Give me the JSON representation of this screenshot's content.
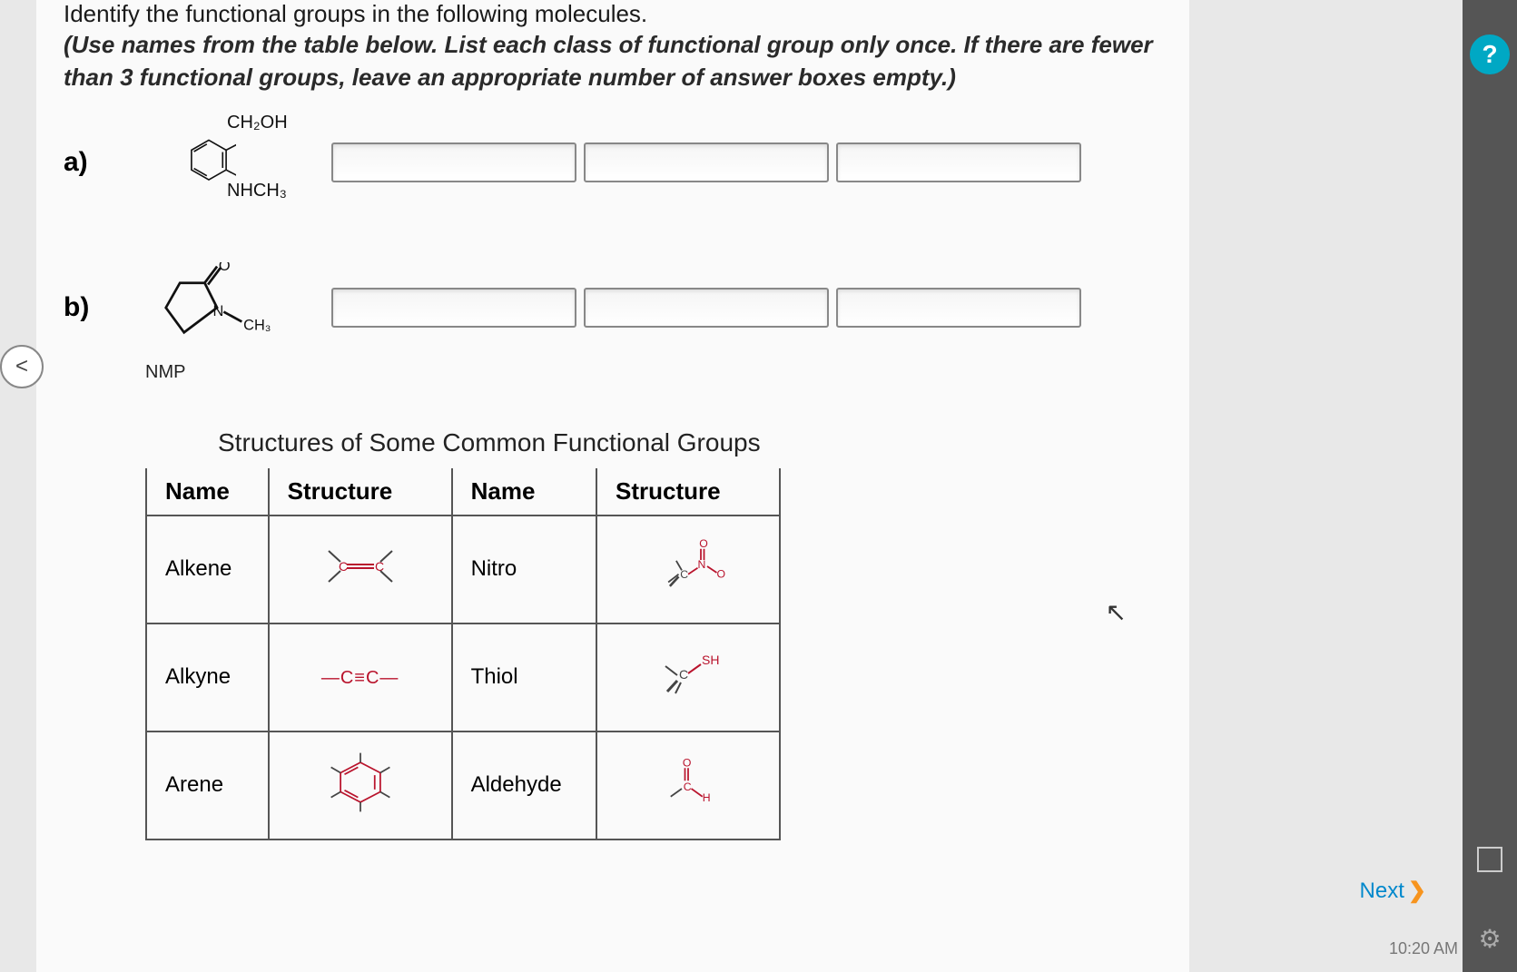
{
  "question": {
    "title": "Identify the functional groups in the following molecules.",
    "instruction": "(Use names from the table below. List each class of functional group only once. If there are fewer than 3 functional groups, leave an appropriate number of answer boxes empty.)"
  },
  "parts": {
    "a": {
      "label": "a)",
      "top_sub": "CH₂OH",
      "bottom_sub": "NHCH₃"
    },
    "b": {
      "label": "b)",
      "o_label": "O",
      "n_sub": "CH₃",
      "name": "NMP"
    }
  },
  "table": {
    "title": "Structures of Some Common Functional Groups",
    "headers": [
      "Name",
      "Structure",
      "Name",
      "Structure"
    ],
    "rows": [
      {
        "name1": "Alkene",
        "struct1": "alkene",
        "name2": "Nitro",
        "struct2": "nitro"
      },
      {
        "name1": "Alkyne",
        "struct1": "alkyne",
        "name2": "Thiol",
        "struct2": "thiol"
      },
      {
        "name1": "Arene",
        "struct1": "arene",
        "name2": "Aldehyde",
        "struct2": "aldehyde"
      }
    ],
    "alkyne_text": "—C≡C—"
  },
  "nav": {
    "prev": "<",
    "next": "Next",
    "help": "?"
  },
  "footer": {
    "time": "10:20 AM"
  }
}
